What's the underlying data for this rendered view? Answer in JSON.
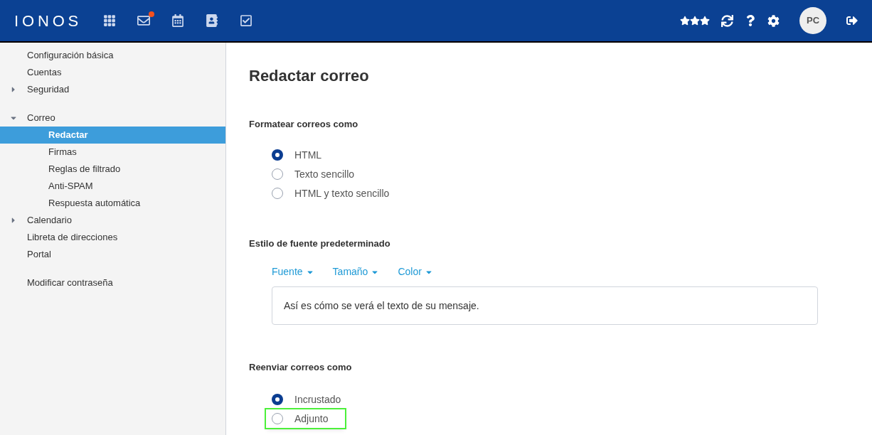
{
  "header": {
    "logo": "IONOS",
    "apps": [
      {
        "kind": "grid",
        "selected": false,
        "notification": false
      },
      {
        "kind": "mail",
        "selected": false,
        "notification": true
      },
      {
        "kind": "calendar",
        "selected": false,
        "notification": false
      },
      {
        "kind": "contacts",
        "selected": false,
        "notification": false
      },
      {
        "kind": "tasks",
        "selected": false,
        "notification": false
      }
    ],
    "avatar": "PC"
  },
  "sidebar": {
    "groups": [
      [
        {
          "label": "Configuración básica",
          "selected": false
        },
        {
          "label": "Cuentas",
          "selected": false
        },
        {
          "label": "Seguridad",
          "selected": false,
          "expanded": false
        }
      ],
      [
        {
          "label": "Correo",
          "selected": false,
          "expanded": true,
          "children": [
            {
              "label": "Redactar",
              "selected": true
            },
            {
              "label": "Firmas",
              "selected": false
            },
            {
              "label": "Reglas de filtrado",
              "selected": false
            },
            {
              "label": "Anti-SPAM",
              "selected": false
            },
            {
              "label": "Respuesta automática",
              "selected": false
            }
          ]
        },
        {
          "label": "Calendario",
          "selected": false,
          "expanded": false
        },
        {
          "label": "Libreta de direcciones",
          "selected": false
        },
        {
          "label": "Portal",
          "selected": false
        }
      ],
      [
        {
          "label": "Modificar contraseña",
          "selected": false
        }
      ]
    ]
  },
  "main": {
    "title": "Redactar correo",
    "format": {
      "heading": "Formatear correos como",
      "options": [
        {
          "label": "HTML",
          "selected": true,
          "highlighted": false
        },
        {
          "label": "Texto sencillo",
          "selected": false,
          "highlighted": false
        },
        {
          "label": "HTML y texto sencillo",
          "selected": false,
          "highlighted": false
        }
      ]
    },
    "font": {
      "heading": "Estilo de fuente predeterminado",
      "menus": [
        "Fuente",
        "Tamaño",
        "Color"
      ],
      "preview": "Así es cómo se verá el texto de su mensaje."
    },
    "forward": {
      "heading": "Reenviar correos como",
      "options": [
        {
          "label": "Incrustado",
          "selected": true,
          "highlighted": false
        },
        {
          "label": "Adjunto",
          "selected": false,
          "highlighted": true
        }
      ]
    }
  }
}
